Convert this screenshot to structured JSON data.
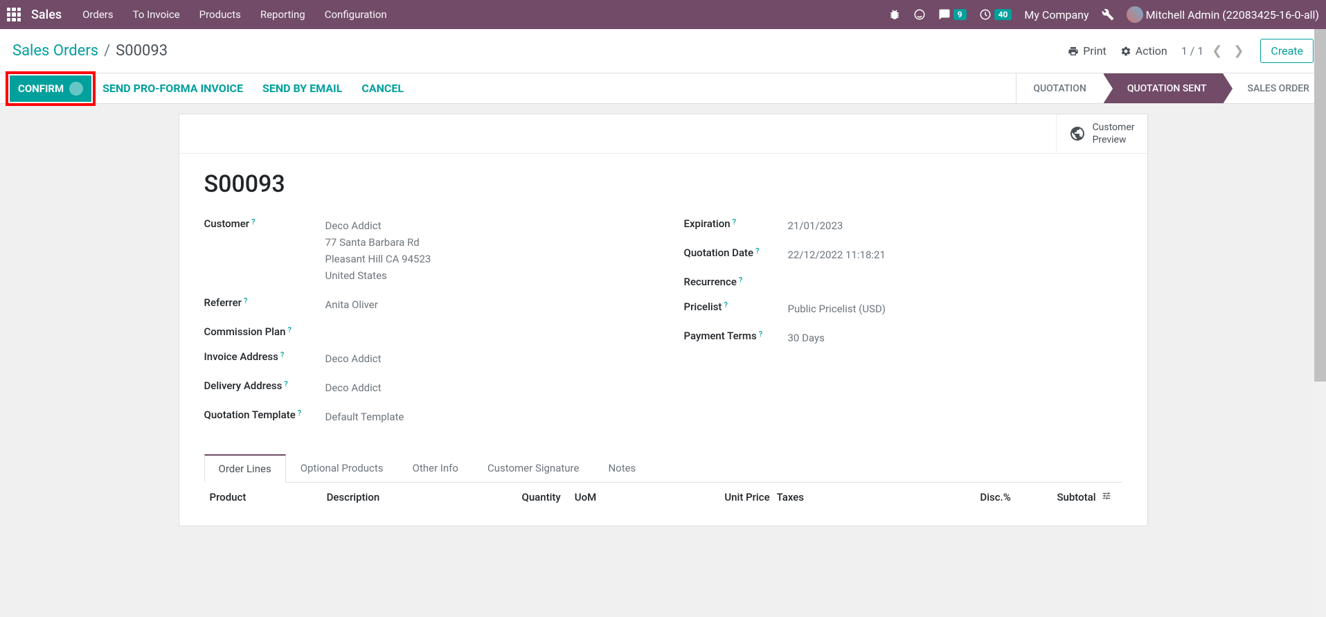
{
  "nav": {
    "brand": "Sales",
    "menu": [
      "Orders",
      "To Invoice",
      "Products",
      "Reporting",
      "Configuration"
    ],
    "msg_badge": "9",
    "clock_badge": "40",
    "company": "My Company",
    "user": "Mitchell Admin (22083425-16-0-all)"
  },
  "breadcrumb": {
    "parent": "Sales Orders",
    "current": "S00093",
    "print": "Print",
    "action": "Action",
    "pager": "1 / 1",
    "create": "Create"
  },
  "actions": {
    "confirm": "CONFIRM",
    "proforma": "SEND PRO-FORMA INVOICE",
    "email": "SEND BY EMAIL",
    "cancel": "CANCEL"
  },
  "status": {
    "quotation": "QUOTATION",
    "sent": "QUOTATION SENT",
    "order": "SALES ORDER"
  },
  "button_box": {
    "preview_l1": "Customer",
    "preview_l2": "Preview"
  },
  "order": {
    "name": "S00093",
    "customer_label": "Customer",
    "customer_name": "Deco Addict",
    "customer_street": "77 Santa Barbara Rd",
    "customer_city": "Pleasant Hill CA 94523",
    "customer_country": "United States",
    "referrer_label": "Referrer",
    "referrer_value": "Anita Oliver",
    "commission_label": "Commission Plan",
    "commission_value": "",
    "invoice_addr_label": "Invoice Address",
    "invoice_addr_value": "Deco Addict",
    "delivery_addr_label": "Delivery Address",
    "delivery_addr_value": "Deco Addict",
    "template_label": "Quotation Template",
    "template_value": "Default Template",
    "expiration_label": "Expiration",
    "expiration_value": "21/01/2023",
    "quote_date_label": "Quotation Date",
    "quote_date_value": "22/12/2022 11:18:21",
    "recurrence_label": "Recurrence",
    "recurrence_value": "",
    "pricelist_label": "Pricelist",
    "pricelist_value": "Public Pricelist (USD)",
    "terms_label": "Payment Terms",
    "terms_value": "30 Days"
  },
  "tabs": {
    "order_lines": "Order Lines",
    "optional": "Optional Products",
    "other": "Other Info",
    "signature": "Customer Signature",
    "notes": "Notes"
  },
  "table": {
    "product": "Product",
    "description": "Description",
    "quantity": "Quantity",
    "uom": "UoM",
    "unit_price": "Unit Price",
    "taxes": "Taxes",
    "disc": "Disc.%",
    "subtotal": "Subtotal"
  },
  "help": "?"
}
